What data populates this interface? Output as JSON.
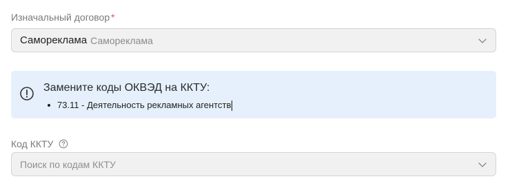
{
  "contract": {
    "label": "Изначальный договор",
    "required_mark": "*",
    "value_main": "Саморекламa",
    "value_sub": "Саморекламa"
  },
  "alert": {
    "icon": "info-circle-icon",
    "title": "Замените коды ОКВЭД на ККТУ:",
    "items": [
      "73.11 - Деятельность рекламных агентств"
    ]
  },
  "kktu": {
    "label": "Код ККТУ",
    "help_icon": "question-circle-icon",
    "placeholder": "Поиск по кодам ККТУ"
  },
  "colors": {
    "required": "#e05252",
    "alert_bg": "#e6f0fc",
    "select_bg": "#f1f1f1"
  }
}
